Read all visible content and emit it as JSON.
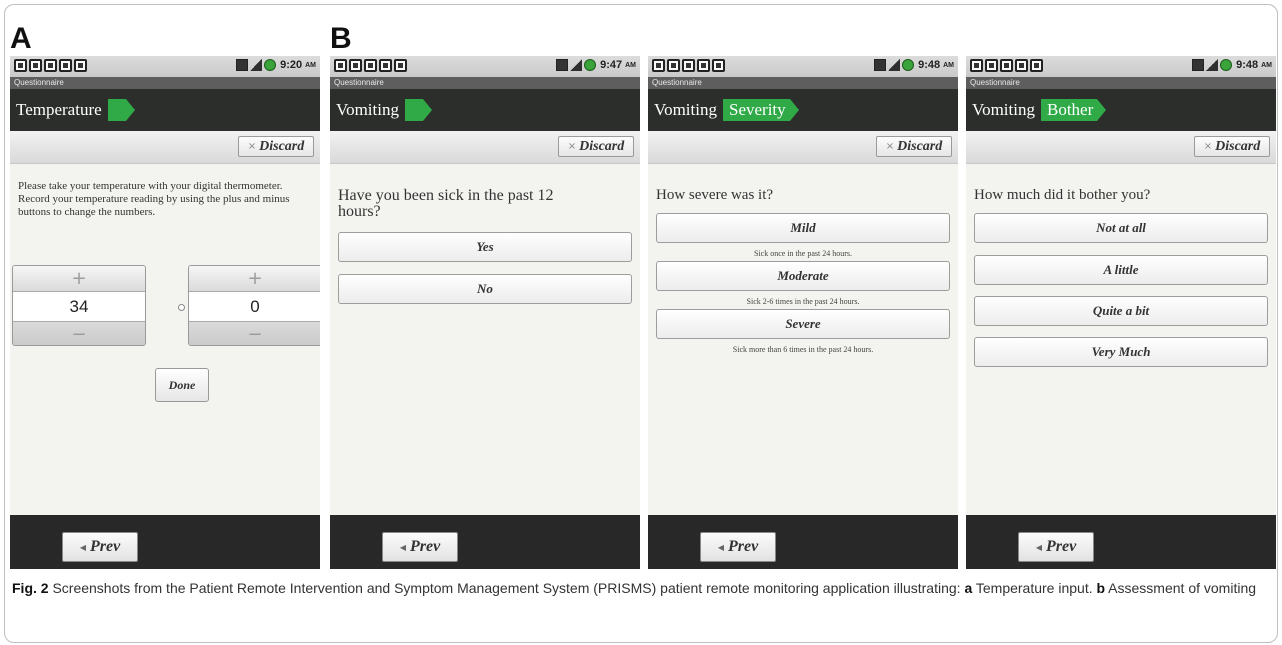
{
  "panel_labels": {
    "a": "A",
    "b": "B"
  },
  "app_name": "Questionnaire",
  "discard_label": "Discard",
  "prev_label": "Prev",
  "ampm": "AM",
  "screens": [
    {
      "time": "9:20",
      "crumbs": [
        "Temperature"
      ],
      "instruction": "Please take your temperature with your digital thermometer. Record your temperature reading by using the plus and minus buttons to change the numbers.",
      "stepper_whole": "34",
      "stepper_decimal": "0",
      "plus_glyph": "+",
      "minus_glyph": "−",
      "done_label": "Done"
    },
    {
      "time": "9:47",
      "crumbs": [
        "Vomiting"
      ],
      "question": "Have you been sick in the past 12 hours?",
      "options": [
        "Yes",
        "No"
      ]
    },
    {
      "time": "9:48",
      "crumbs": [
        "Vomiting",
        "Severity"
      ],
      "question": "How severe was it?",
      "options": [
        {
          "label": "Mild",
          "note": "Sick once in the past 24 hours."
        },
        {
          "label": "Moderate",
          "note": "Sick 2-6 times in the past 24 hours."
        },
        {
          "label": "Severe",
          "note": "Sick more than 6 times in the past 24 hours."
        }
      ]
    },
    {
      "time": "9:48",
      "crumbs": [
        "Vomiting",
        "Bother"
      ],
      "question": "How much did it bother you?",
      "options": [
        "Not at all",
        "A little",
        "Quite a bit",
        "Very Much"
      ]
    }
  ],
  "caption": {
    "fig_label": "Fig. 2",
    "text_1": " Screenshots from the Patient Remote Intervention and Symptom Management System (PRISMS) patient remote monitoring application illustrating: ",
    "a_label": "a",
    "a_text": " Temperature input. ",
    "b_label": "b",
    "b_text": " Assessment of vomiting"
  }
}
